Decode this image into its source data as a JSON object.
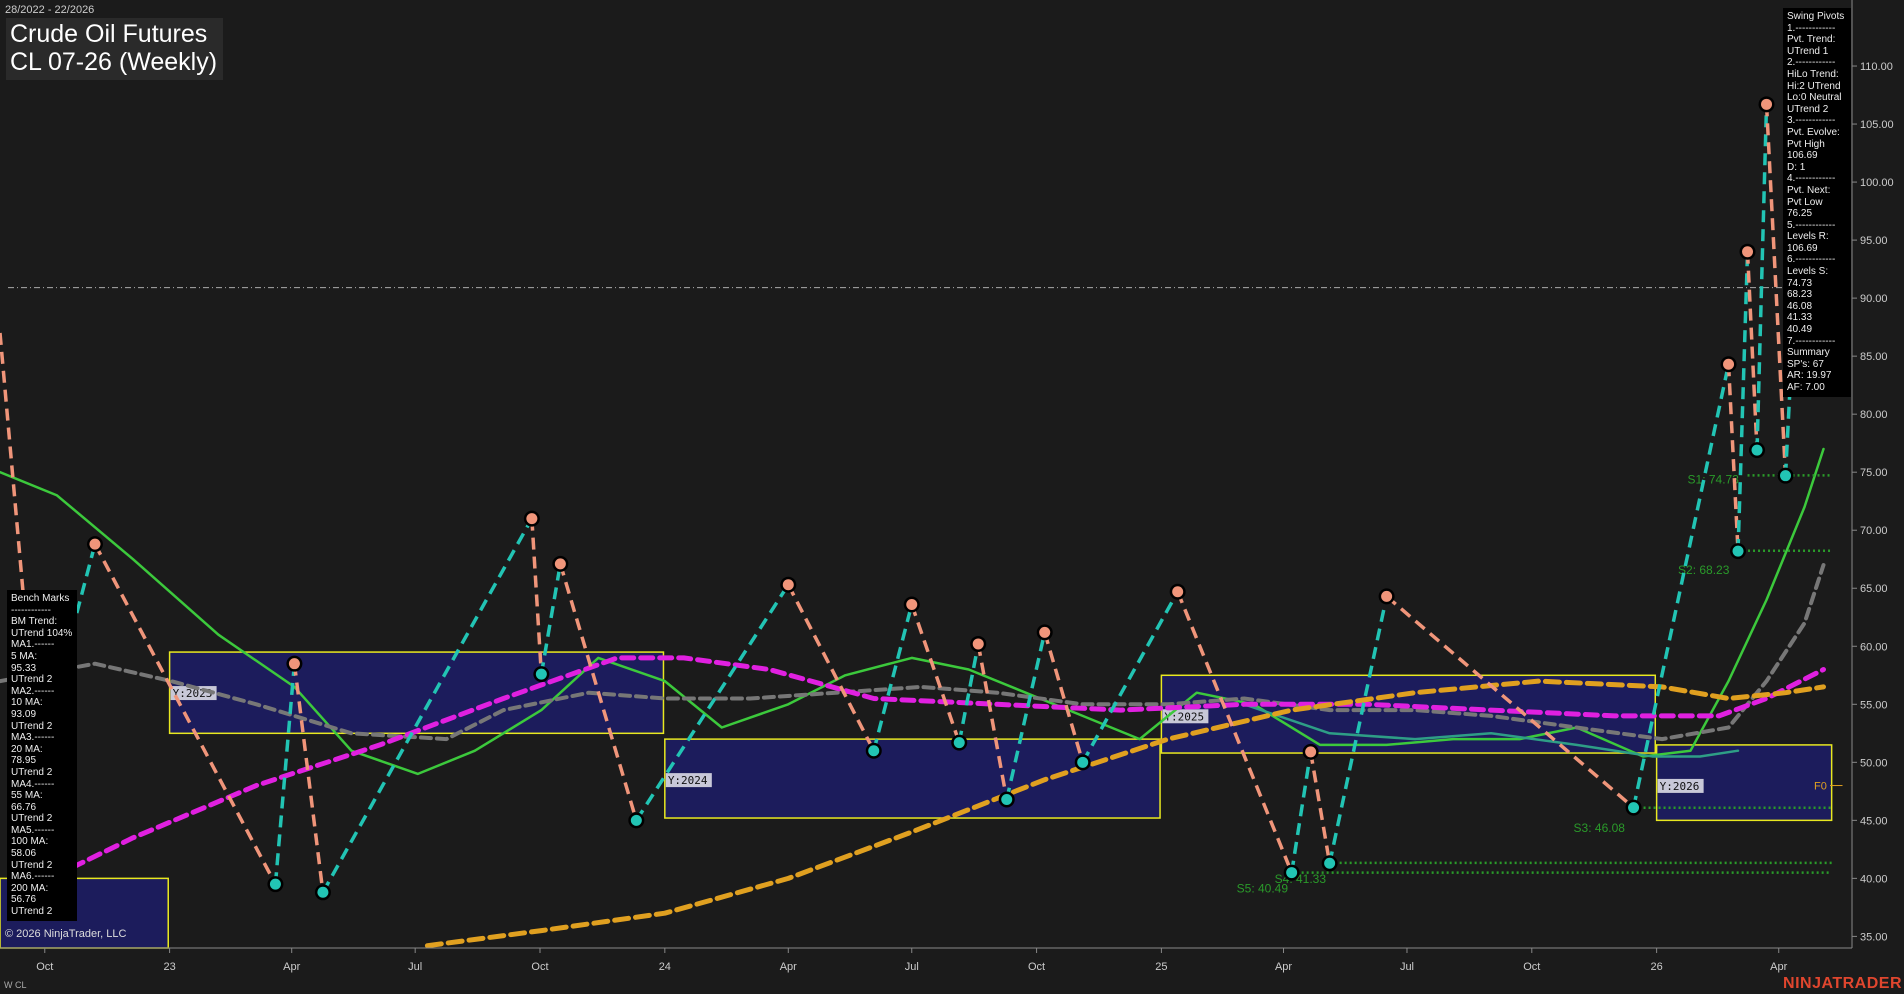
{
  "header": {
    "date_range": "28/2022 - 22/2026",
    "title": "Crude Oil Futures",
    "subtitle": "CL 07-26 (Weekly)"
  },
  "copyright": "© 2026 NinjaTrader, LLC",
  "symbol_label": "W CL",
  "brand": "NINJATRADER",
  "swing_pivots_panel": [
    "Swing Pivots",
    "1.------------",
    "Pvt. Trend:",
    "UTrend 1",
    "2.------------",
    "HiLo Trend:",
    "Hi:2 UTrend",
    "Lo:0 Neutral",
    "UTrend 2",
    "3.------------",
    "Pvt. Evolve:",
    "Pvt High",
    "106.69",
    "D: 1",
    "4.------------",
    "Pvt. Next:",
    "Pvt Low",
    "76.25",
    "5.------------",
    "Levels R:",
    "106.69",
    "6.------------",
    "Levels S:",
    "74.73",
    "68.23",
    "46.08",
    "41.33",
    "40.49",
    "7.------------",
    "Summary",
    "SP's: 67",
    "AR: 19.97",
    "AF: 7.00"
  ],
  "bench_marks_panel": [
    "Bench Marks",
    "------------",
    "BM Trend:",
    "UTrend 104%",
    "MA1.------",
    "5 MA:",
    "95.33",
    "UTrend 2",
    "MA2.------",
    "10 MA:",
    "93.09",
    "UTrend 2",
    "MA3.------",
    "20 MA:",
    "78.95",
    "UTrend 2",
    "MA4.------",
    "55 MA:",
    "66.76",
    "UTrend 2",
    "MA5.------",
    "100 MA:",
    "58.06",
    "UTrend 2",
    "MA6.------",
    "200 MA:",
    "56.76",
    "UTrend 2"
  ],
  "colors": {
    "background": "#1b1b1b",
    "pivot_high": "#f0957a",
    "pivot_low": "#22c4b4",
    "ma_fast": "#3cc93c",
    "ma_mid": "#777777",
    "ma_teal": "#2e9e86",
    "ma_magenta": "#e020e0",
    "ma_orange": "#e0a020",
    "ma_tan": "#b08050",
    "year_box": "#e8e820",
    "year_box_fill": "#1c1c5c",
    "resistance": "#e02020",
    "support": "#2a9a2a"
  },
  "chart_data": {
    "type": "line",
    "title": "CL 07-26 (Weekly)",
    "y_axis": {
      "ticks": [
        35,
        40,
        45,
        50,
        55,
        60,
        65,
        70,
        75,
        80,
        85,
        90,
        95,
        100,
        105,
        110
      ],
      "tick_labels": [
        "35.00",
        "40.00",
        "45.00",
        "50.00",
        "55.00",
        "60.00",
        "65.00",
        "70.00",
        "75.00",
        "80.00",
        "85.00",
        "90.00",
        "95.00",
        "100.00",
        "105.00",
        "110.00"
      ],
      "range": [
        34,
        115
      ]
    },
    "x_axis": {
      "range": [
        "2022-08-29",
        "2026-05-25"
      ],
      "ticks": [
        {
          "date": "2022-10-01",
          "label": "Oct"
        },
        {
          "date": "2023-01-01",
          "label": "23"
        },
        {
          "date": "2023-04-01",
          "label": "Apr"
        },
        {
          "date": "2023-07-01",
          "label": "Jul"
        },
        {
          "date": "2023-10-01",
          "label": "Oct"
        },
        {
          "date": "2024-01-01",
          "label": "24"
        },
        {
          "date": "2024-04-01",
          "label": "Apr"
        },
        {
          "date": "2024-07-01",
          "label": "Jul"
        },
        {
          "date": "2024-10-01",
          "label": "Oct"
        },
        {
          "date": "2025-01-01",
          "label": "25"
        },
        {
          "date": "2025-04-01",
          "label": "Apr"
        },
        {
          "date": "2025-07-01",
          "label": "Jul"
        },
        {
          "date": "2025-10-01",
          "label": "Oct"
        },
        {
          "date": "2026-01-01",
          "label": "26"
        },
        {
          "date": "2026-04-01",
          "label": "Apr"
        }
      ]
    },
    "current_price_line": 90.9,
    "swing_pivots": [
      {
        "date": "2022-09-26",
        "price": 50.2,
        "type": "low"
      },
      {
        "date": "2022-11-07",
        "price": 68.8,
        "type": "high"
      },
      {
        "date": "2023-03-20",
        "price": 39.5,
        "type": "low"
      },
      {
        "date": "2023-04-03",
        "price": 58.5,
        "type": "high"
      },
      {
        "date": "2023-04-24",
        "price": 38.8,
        "type": "low"
      },
      {
        "date": "2023-09-25",
        "price": 71.0,
        "type": "high"
      },
      {
        "date": "2023-10-02",
        "price": 57.6,
        "type": "low"
      },
      {
        "date": "2023-10-16",
        "price": 67.1,
        "type": "high"
      },
      {
        "date": "2023-12-11",
        "price": 45.0,
        "type": "low"
      },
      {
        "date": "2024-04-01",
        "price": 65.3,
        "type": "high"
      },
      {
        "date": "2024-06-03",
        "price": 51.0,
        "type": "low"
      },
      {
        "date": "2024-07-01",
        "price": 63.6,
        "type": "high"
      },
      {
        "date": "2024-08-05",
        "price": 51.7,
        "type": "low"
      },
      {
        "date": "2024-08-19",
        "price": 60.2,
        "type": "high"
      },
      {
        "date": "2024-09-09",
        "price": 46.8,
        "type": "low"
      },
      {
        "date": "2024-10-07",
        "price": 61.2,
        "type": "high"
      },
      {
        "date": "2024-11-04",
        "price": 50.0,
        "type": "low"
      },
      {
        "date": "2025-01-13",
        "price": 64.7,
        "type": "high"
      },
      {
        "date": "2025-04-07",
        "price": 40.5,
        "type": "low"
      },
      {
        "date": "2025-04-21",
        "price": 50.9,
        "type": "high"
      },
      {
        "date": "2025-05-05",
        "price": 41.3,
        "type": "low"
      },
      {
        "date": "2025-06-16",
        "price": 64.3,
        "type": "high"
      },
      {
        "date": "2025-12-15",
        "price": 46.1,
        "type": "low"
      },
      {
        "date": "2026-02-23",
        "price": 84.3,
        "type": "high"
      },
      {
        "date": "2026-03-02",
        "price": 68.2,
        "type": "low"
      },
      {
        "date": "2026-03-09",
        "price": 94.0,
        "type": "high"
      },
      {
        "date": "2026-03-16",
        "price": 76.9,
        "type": "low"
      },
      {
        "date": "2026-03-23",
        "price": 106.7,
        "type": "high"
      },
      {
        "date": "2026-04-06",
        "price": 74.7,
        "type": "low"
      },
      {
        "date": "2026-04-20",
        "price": 106.7,
        "type": "high"
      }
    ],
    "support_levels": [
      {
        "price": 74.73,
        "label": "S1: 74.73",
        "from": "2026-03-09"
      },
      {
        "price": 68.23,
        "label": "S2: 68.23",
        "from": "2026-03-02"
      },
      {
        "price": 46.08,
        "label": "S3: 46.08",
        "from": "2025-12-15"
      },
      {
        "price": 41.33,
        "label": "S4: 41.33",
        "from": "2025-05-05"
      },
      {
        "price": 40.49,
        "label": "S5: 40.49",
        "from": "2025-04-07"
      }
    ],
    "resistance_levels": [
      {
        "price": 106.69,
        "from": "2026-04-20"
      }
    ],
    "year_boxes": [
      {
        "label": "Y:2023",
        "start": "2023-01-01",
        "end": "2023-12-31",
        "low": 52.5,
        "high": 59.5
      },
      {
        "label": "Y:2024",
        "start": "2024-01-01",
        "end": "2024-12-31",
        "low": 45.2,
        "high": 52.0
      },
      {
        "label": "Y:2025",
        "start": "2025-01-01",
        "end": "2025-12-31",
        "low": 50.8,
        "high": 57.5
      },
      {
        "label": "Y:2026",
        "start": "2026-01-01",
        "end": "2026-05-10",
        "low": 45.0,
        "high": 51.5
      },
      {
        "label": "",
        "start": "2022-08-29",
        "end": "2022-12-31",
        "low": 34,
        "high": 40.0
      }
    ],
    "fib_label": {
      "text": "F0",
      "date": "2026-04-27",
      "price": 48.0
    },
    "series": [
      {
        "key": "ma_fast",
        "style": "solid",
        "points": [
          [
            "2022-08-29",
            75.0
          ],
          [
            "2022-10-10",
            73.0
          ],
          [
            "2022-12-05",
            67.5
          ],
          [
            "2023-02-06",
            61.0
          ],
          [
            "2023-04-03",
            56.5
          ],
          [
            "2023-05-15",
            51.0
          ],
          [
            "2023-07-03",
            49.0
          ],
          [
            "2023-08-14",
            51.0
          ],
          [
            "2023-10-02",
            54.5
          ],
          [
            "2023-11-13",
            59.0
          ],
          [
            "2024-01-01",
            57.0
          ],
          [
            "2024-02-12",
            53.0
          ],
          [
            "2024-04-01",
            55.0
          ],
          [
            "2024-05-13",
            57.5
          ],
          [
            "2024-07-01",
            59.0
          ],
          [
            "2024-08-12",
            58.0
          ],
          [
            "2024-09-23",
            56.0
          ],
          [
            "2024-11-04",
            54.0
          ],
          [
            "2024-12-16",
            52.0
          ],
          [
            "2025-01-27",
            56.0
          ],
          [
            "2025-03-10",
            55.0
          ],
          [
            "2025-04-28",
            51.5
          ],
          [
            "2025-06-16",
            51.5
          ],
          [
            "2025-08-04",
            52.0
          ],
          [
            "2025-09-22",
            52.0
          ],
          [
            "2025-11-03",
            53.0
          ],
          [
            "2025-12-22",
            50.5
          ],
          [
            "2026-01-26",
            51.0
          ],
          [
            "2026-02-23",
            57.0
          ],
          [
            "2026-03-23",
            64.0
          ],
          [
            "2026-04-20",
            72.0
          ],
          [
            "2026-05-04",
            77.0
          ]
        ]
      },
      {
        "key": "ma_mid",
        "style": "dashed",
        "points": [
          [
            "2022-08-29",
            57.0
          ],
          [
            "2022-11-07",
            58.5
          ],
          [
            "2023-01-02",
            57.0
          ],
          [
            "2023-03-06",
            55.0
          ],
          [
            "2023-05-15",
            52.5
          ],
          [
            "2023-07-24",
            52.0
          ],
          [
            "2023-09-04",
            54.5
          ],
          [
            "2023-11-06",
            56.0
          ],
          [
            "2024-01-01",
            55.5
          ],
          [
            "2024-03-04",
            55.5
          ],
          [
            "2024-05-06",
            56.0
          ],
          [
            "2024-07-08",
            56.5
          ],
          [
            "2024-09-02",
            56.0
          ],
          [
            "2024-11-04",
            55.0
          ],
          [
            "2025-01-06",
            55.0
          ],
          [
            "2025-03-03",
            55.5
          ],
          [
            "2025-05-05",
            54.5
          ],
          [
            "2025-07-07",
            54.5
          ],
          [
            "2025-09-01",
            54.0
          ],
          [
            "2025-11-03",
            53.0
          ],
          [
            "2026-01-05",
            52.0
          ],
          [
            "2026-02-23",
            53.0
          ],
          [
            "2026-03-23",
            57.0
          ],
          [
            "2026-04-20",
            62.0
          ],
          [
            "2026-05-04",
            67.0
          ]
        ]
      },
      {
        "key": "ma_teal",
        "style": "solid",
        "points": [
          [
            "2025-03-03",
            55.0
          ],
          [
            "2025-05-05",
            52.5
          ],
          [
            "2025-07-07",
            52.0
          ],
          [
            "2025-09-01",
            52.5
          ],
          [
            "2025-11-03",
            51.5
          ],
          [
            "2025-12-29",
            50.5
          ],
          [
            "2026-02-02",
            50.5
          ],
          [
            "2026-03-02",
            51.0
          ]
        ]
      },
      {
        "key": "ma_magenta",
        "style": "dashed",
        "points": [
          [
            "2022-09-26",
            39.5
          ],
          [
            "2022-12-05",
            43.5
          ],
          [
            "2023-03-06",
            48.0
          ],
          [
            "2023-06-05",
            51.5
          ],
          [
            "2023-09-04",
            55.5
          ],
          [
            "2023-11-27",
            59.0
          ],
          [
            "2024-01-15",
            59.0
          ],
          [
            "2024-03-18",
            58.0
          ],
          [
            "2024-06-03",
            55.5
          ],
          [
            "2024-09-02",
            55.0
          ],
          [
            "2024-12-02",
            54.5
          ],
          [
            "2025-03-03",
            55.0
          ],
          [
            "2025-06-02",
            55.0
          ],
          [
            "2025-09-01",
            54.5
          ],
          [
            "2025-12-01",
            54.0
          ],
          [
            "2026-02-16",
            54.0
          ],
          [
            "2026-03-23",
            55.5
          ],
          [
            "2026-05-04",
            58.0
          ]
        ]
      },
      {
        "key": "ma_orange",
        "style": "dashed",
        "points": [
          [
            "2023-07-10",
            34.2
          ],
          [
            "2023-10-02",
            35.5
          ],
          [
            "2024-01-01",
            37.0
          ],
          [
            "2024-04-01",
            40.0
          ],
          [
            "2024-07-01",
            44.0
          ],
          [
            "2024-10-07",
            48.5
          ],
          [
            "2025-01-06",
            52.0
          ],
          [
            "2025-04-07",
            54.5
          ],
          [
            "2025-07-07",
            56.0
          ],
          [
            "2025-10-06",
            57.0
          ],
          [
            "2026-01-05",
            56.5
          ],
          [
            "2026-02-23",
            55.5
          ],
          [
            "2026-04-06",
            56.0
          ],
          [
            "2026-05-04",
            56.5
          ]
        ]
      }
    ]
  }
}
